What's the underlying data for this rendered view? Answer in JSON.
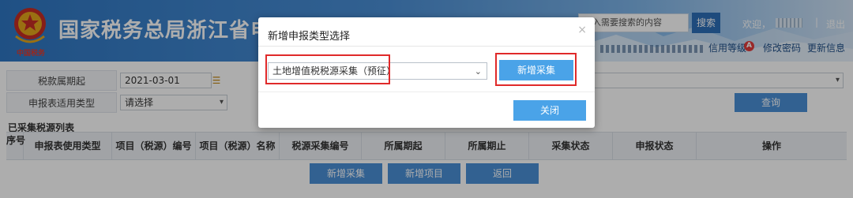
{
  "header": {
    "title": "国家税务总局浙江省电子税",
    "emblem_text": "中国税务",
    "search_placeholder": "输入需要搜索的内容",
    "search_button": "搜索",
    "welcome": "欢迎，",
    "separator": "|",
    "logout": "退出",
    "credit_level": "信用等级",
    "credit_badge": "A",
    "change_password": "修改密码",
    "update_info": "更新信息"
  },
  "form": {
    "tax_period_label": "税款属期起",
    "tax_period_value": "2021-03-01",
    "report_type_label": "申报表适用类型",
    "report_type_value": "请选择",
    "query_button": "查询"
  },
  "list": {
    "title": "已采集税源列表",
    "columns": [
      "序号",
      "申报表使用类型",
      "项目（税源）编号",
      "项目（税源）名称",
      "税源采集编号",
      "所属期起",
      "所属期止",
      "采集状态",
      "申报状态",
      "操作"
    ]
  },
  "bottom_buttons": [
    "新增采集",
    "新增项目",
    "返回"
  ],
  "modal": {
    "title": "新增申报类型选择",
    "close_icon": "×",
    "select_value": "土地增值税税源采集（预征）",
    "add_button": "新增采集",
    "close_button": "关闭"
  },
  "colors": {
    "primary_button": "#4a8fd6",
    "modal_button": "#4aa3e8",
    "highlight_border": "#e02a2a",
    "header_blue": "#2f77c3"
  }
}
